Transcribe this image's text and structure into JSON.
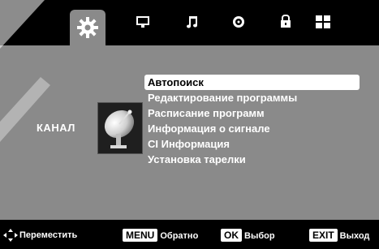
{
  "tabs": [
    {
      "icon": "gear-icon",
      "active": true
    },
    {
      "icon": "monitor-icon",
      "active": false
    },
    {
      "icon": "music-note-icon",
      "active": false
    },
    {
      "icon": "clock-icon",
      "active": false
    },
    {
      "icon": "lock-icon",
      "active": false
    },
    {
      "icon": "grid-icon",
      "active": false
    }
  ],
  "section": {
    "label": "КАНАЛ",
    "icon": "satellite-dish-icon"
  },
  "menu": {
    "selected_index": 0,
    "items": [
      "Автопоиск",
      "Редактирование программы",
      "Расписание программ",
      "Информация о сигнале",
      "CI Информация",
      "Установка тарелки"
    ]
  },
  "help": {
    "move_icon": "dpad-arrows-icon",
    "move_label": "Переместить",
    "menu_key": "MENU",
    "menu_label": "Обратно",
    "ok_key": "OK",
    "ok_label": "Выбор",
    "exit_key": "EXIT",
    "exit_label": "Выход"
  },
  "colors": {
    "panel": "#8a8a8a",
    "bars": "#000000",
    "highlight": "#ffffff"
  }
}
